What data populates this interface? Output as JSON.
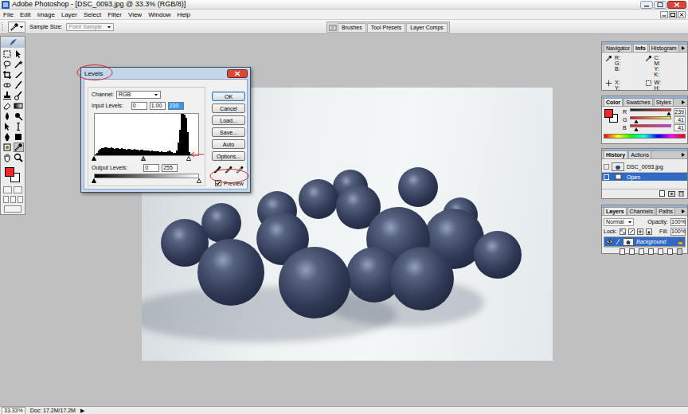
{
  "window": {
    "title": "Adobe Photoshop - [DSC_0093.jpg @ 33.3% (RGB/8)]"
  },
  "menu": [
    "File",
    "Edit",
    "Image",
    "Layer",
    "Select",
    "Filter",
    "View",
    "Window",
    "Help"
  ],
  "options_bar": {
    "sample_size_label": "Sample Size:",
    "sample_size": "Point Sample",
    "palette_well_tabs": [
      "Brushes",
      "Tool Presets",
      "Layer Comps"
    ]
  },
  "toolbox": {
    "tools": [
      {
        "selected": false
      },
      {
        "selected": false
      },
      {
        "selected": false
      },
      {
        "selected": false
      },
      {
        "selected": false
      },
      {
        "selected": false
      },
      {
        "selected": false
      },
      {
        "selected": false
      },
      {
        "selected": false
      },
      {
        "selected": false
      },
      {
        "selected": false
      },
      {
        "selected": false
      },
      {
        "selected": false
      },
      {
        "selected": false
      },
      {
        "selected": false
      },
      {
        "selected": false
      },
      {
        "selected": false
      },
      {
        "selected": false
      },
      {
        "selected": false
      },
      {
        "selected": true
      },
      {
        "selected": false
      },
      {
        "selected": false
      }
    ],
    "foreground": "#ef2929",
    "background": "#ffffff"
  },
  "levels": {
    "title": "Levels",
    "channel_label": "Channel:",
    "channel": "RGB",
    "input_label": "Input Levels:",
    "inputs": [
      {
        "value": "0",
        "selected": false
      },
      {
        "value": "1.00",
        "selected": false
      },
      {
        "value": "230",
        "selected": true
      }
    ],
    "histogram": [
      0.02,
      0.06,
      0.12,
      0.16,
      0.18,
      0.17,
      0.19,
      0.2,
      0.18,
      0.17,
      0.19,
      0.18,
      0.16,
      0.17,
      0.18,
      0.16,
      0.15,
      0.17,
      0.16,
      0.15,
      0.14,
      0.16,
      0.15,
      0.14,
      0.13,
      0.15,
      0.14,
      0.13,
      0.12,
      0.14,
      0.13,
      0.12,
      0.11,
      0.12,
      0.11,
      0.1,
      0.11,
      0.1,
      0.09,
      0.1,
      0.09,
      0.08,
      0.09,
      0.08,
      0.07,
      0.08,
      0.09,
      0.12,
      0.1,
      0.07,
      0.05,
      0.06,
      0.12,
      0.3,
      0.62,
      1.0,
      1.0,
      0.98,
      0.9,
      0.55,
      0.08,
      0.01,
      0,
      0,
      0,
      0
    ],
    "input_sliders": [
      0,
      0.47,
      0.902
    ],
    "output_label": "Output Levels:",
    "outputs": [
      "0",
      "255"
    ],
    "output_sliders": [
      0,
      1
    ],
    "buttons": [
      {
        "label": "OK",
        "default": true
      },
      {
        "label": "Cancel",
        "default": false
      },
      {
        "label": "Load...",
        "default": false
      },
      {
        "label": "Save...",
        "default": false
      },
      {
        "label": "Auto",
        "default": false
      },
      {
        "label": "Options...",
        "default": false
      }
    ],
    "preview": {
      "label": "Preview",
      "checked": true
    }
  },
  "panels": {
    "navigator": {
      "tabs": [
        {
          "label": "Navigator",
          "selected": false
        },
        {
          "label": "Info",
          "selected": true
        },
        {
          "label": "Histogram",
          "selected": false
        }
      ],
      "info": [
        [
          "R:",
          "G:",
          "B:"
        ],
        [
          "C:",
          "M:",
          "Y:",
          "K:"
        ],
        [
          "X:",
          "Y:"
        ],
        [
          "W:",
          "H:"
        ]
      ]
    },
    "color": {
      "tabs": [
        {
          "label": "Color",
          "selected": true
        },
        {
          "label": "Swatches",
          "selected": false
        },
        {
          "label": "Styles",
          "selected": false
        }
      ],
      "channels": [
        {
          "label": "R",
          "value": "239",
          "level": 0.937
        },
        {
          "label": "G",
          "value": "41",
          "level": 0.161
        },
        {
          "label": "B",
          "value": "41",
          "level": 0.161
        }
      ]
    },
    "history": {
      "tabs": [
        {
          "label": "History",
          "selected": true
        },
        {
          "label": "Actions",
          "selected": false
        }
      ],
      "items": [
        {
          "label": "DSC_0093.jpg",
          "kind": "snapshot",
          "selected": false
        },
        {
          "label": "Open",
          "kind": "step",
          "selected": true
        }
      ]
    },
    "layers": {
      "tabs": [
        {
          "label": "Layers",
          "selected": true
        },
        {
          "label": "Channels",
          "selected": false
        },
        {
          "label": "Paths",
          "selected": false
        }
      ],
      "blend_mode": "Normal",
      "opacity_label": "Opacity:",
      "opacity": "100%",
      "lock_label": "Lock:",
      "fill_label": "Fill:",
      "fill": "100%",
      "layers": [
        {
          "name": "Background",
          "selected": true,
          "visible": true
        }
      ]
    }
  },
  "status_bar": {
    "zoom": "33.33%",
    "doc": "Doc: 17.2M/17.2M",
    "arrow": "▶"
  }
}
